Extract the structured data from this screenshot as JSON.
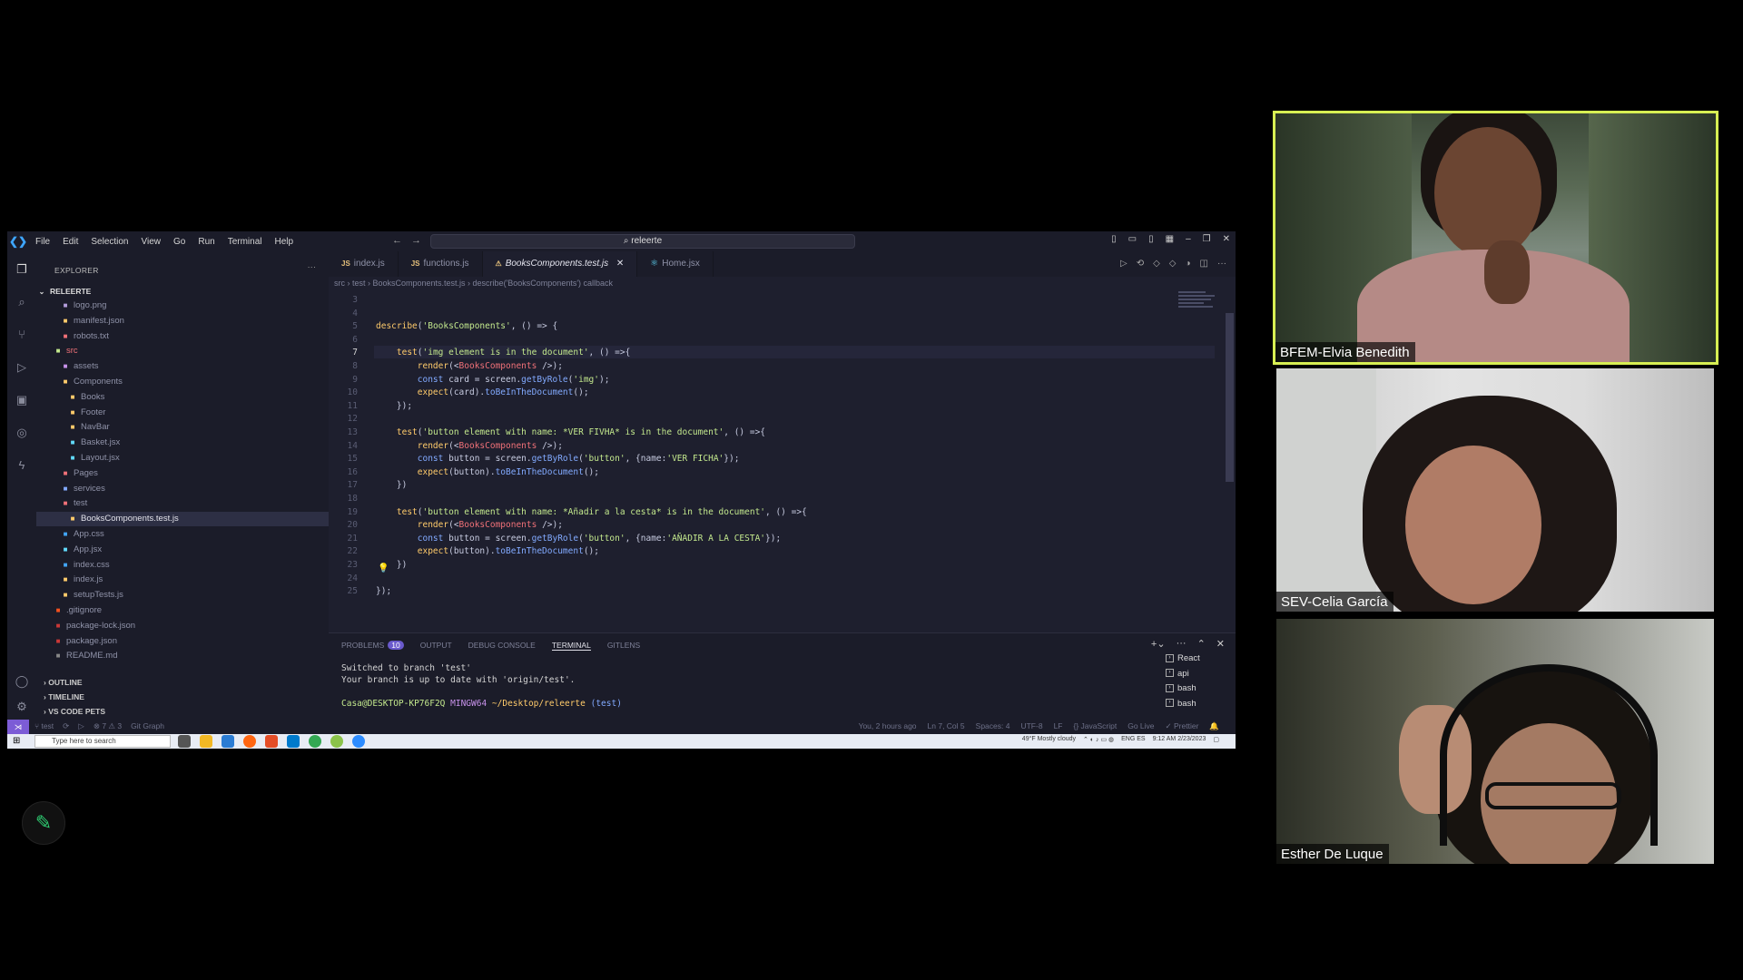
{
  "titlebar": {
    "menu": [
      "File",
      "Edit",
      "Selection",
      "View",
      "Go",
      "Run",
      "Terminal",
      "Help"
    ],
    "search_value": "releerte"
  },
  "explorer": {
    "header": "EXPLORER",
    "project": "RELEERTE",
    "items": [
      {
        "label": "logo.png",
        "indent": 2,
        "icon": "image-icon",
        "color": "#b39ddb"
      },
      {
        "label": "manifest.json",
        "indent": 2,
        "icon": "json-icon",
        "color": "#ffcb6b"
      },
      {
        "label": "robots.txt",
        "indent": 2,
        "icon": "text-file-icon",
        "color": "#f07178"
      },
      {
        "label": "src",
        "indent": 1,
        "icon": "folder-open-icon",
        "color": "#c3e88d",
        "text_color": "#f07178"
      },
      {
        "label": "assets",
        "indent": 2,
        "icon": "folder-icon",
        "color": "#c792ea"
      },
      {
        "label": "Components",
        "indent": 2,
        "icon": "folder-open-icon",
        "color": "#ffcb6b"
      },
      {
        "label": "Books",
        "indent": 3,
        "icon": "folder-icon",
        "color": "#ffcb6b"
      },
      {
        "label": "Footer",
        "indent": 3,
        "icon": "folder-icon",
        "color": "#ffcb6b"
      },
      {
        "label": "NavBar",
        "indent": 3,
        "icon": "folder-icon",
        "color": "#ffcb6b"
      },
      {
        "label": "Basket.jsx",
        "indent": 3,
        "icon": "react-icon",
        "color": "#61dafb"
      },
      {
        "label": "Layout.jsx",
        "indent": 3,
        "icon": "react-icon",
        "color": "#61dafb"
      },
      {
        "label": "Pages",
        "indent": 2,
        "icon": "folder-icon",
        "color": "#f07178"
      },
      {
        "label": "services",
        "indent": 2,
        "icon": "folder-icon",
        "color": "#82aaff"
      },
      {
        "label": "test",
        "indent": 2,
        "icon": "folder-open-icon",
        "color": "#f07178"
      },
      {
        "label": "BooksComponents.test.js",
        "indent": 3,
        "icon": "test-icon",
        "color": "#ffcb6b",
        "selected": true
      },
      {
        "label": "App.css",
        "indent": 2,
        "icon": "css-icon",
        "color": "#42a5f5"
      },
      {
        "label": "App.jsx",
        "indent": 2,
        "icon": "react-icon",
        "color": "#61dafb"
      },
      {
        "label": "index.css",
        "indent": 2,
        "icon": "css-icon",
        "color": "#42a5f5"
      },
      {
        "label": "index.js",
        "indent": 2,
        "icon": "js-icon",
        "color": "#ffcb6b"
      },
      {
        "label": "setupTests.js",
        "indent": 2,
        "icon": "js-icon",
        "color": "#ffcb6b"
      },
      {
        "label": ".gitignore",
        "indent": 1,
        "icon": "git-icon",
        "color": "#f4511e"
      },
      {
        "label": "package-lock.json",
        "indent": 1,
        "icon": "npm-icon",
        "color": "#cb3837"
      },
      {
        "label": "package.json",
        "indent": 1,
        "icon": "npm-icon",
        "color": "#cb3837"
      },
      {
        "label": "README.md",
        "indent": 1,
        "icon": "markdown-icon",
        "color": "#888"
      }
    ],
    "sections": [
      "OUTLINE",
      "TIMELINE",
      "VS CODE PETS"
    ]
  },
  "tabs": [
    {
      "label": "index.js",
      "lang": "JS"
    },
    {
      "label": "functions.js",
      "lang": "JS"
    },
    {
      "label": "BooksComponents.test.js",
      "lang": "test",
      "active": true
    },
    {
      "label": "Home.jsx",
      "lang": "react"
    }
  ],
  "breadcrumb": "src › test › BooksComponents.test.js › describe('BooksComponents') callback",
  "editor": {
    "lines": [
      {
        "n": "3",
        "code": ""
      },
      {
        "n": "4",
        "code": ""
      },
      {
        "n": "5",
        "code": "describe('BooksComponents', () => {"
      },
      {
        "n": "6",
        "code": ""
      },
      {
        "n": "7",
        "code": "    test('img element is in the document', () =>{"
      },
      {
        "n": "8",
        "code": "        render(<BooksComponents />);"
      },
      {
        "n": "9",
        "code": "        const card = screen.getByRole('img');"
      },
      {
        "n": "10",
        "code": "        expect(card).toBeInTheDocument();"
      },
      {
        "n": "11",
        "code": "    });"
      },
      {
        "n": "12",
        "code": ""
      },
      {
        "n": "13",
        "code": "    test('button element with name: *VER FIVHA* is in the document', () =>{"
      },
      {
        "n": "14",
        "code": "        render(<BooksComponents />);"
      },
      {
        "n": "15",
        "code": "        const button = screen.getByRole('button', {name:'VER FICHA'});"
      },
      {
        "n": "16",
        "code": "        expect(button).toBeInTheDocument();"
      },
      {
        "n": "17",
        "code": "    })"
      },
      {
        "n": "18",
        "code": ""
      },
      {
        "n": "19",
        "code": "    test('button element with name: *Añadir a la cesta* is in the document', () =>{"
      },
      {
        "n": "20",
        "code": "        render(<BooksComponents />);"
      },
      {
        "n": "21",
        "code": "        const button = screen.getByRole('button', {name:'AÑADIR A LA CESTA'});"
      },
      {
        "n": "22",
        "code": "        expect(button).toBeInTheDocument();"
      },
      {
        "n": "23",
        "code": "    })"
      },
      {
        "n": "24",
        "code": ""
      },
      {
        "n": "25",
        "code": "});"
      }
    ],
    "current_line": "7"
  },
  "panel": {
    "tabs": [
      "PROBLEMS",
      "OUTPUT",
      "DEBUG CONSOLE",
      "TERMINAL",
      "GITLENS"
    ],
    "problems_count": "10",
    "active_tab": "TERMINAL",
    "terminal_lines": [
      "Switched to branch 'test'",
      "Your branch is up to date with 'origin/test'."
    ],
    "prompt": {
      "user": "Casa@DESKTOP-KP76F2Q",
      "shell": "MINGW64",
      "path": "~/Desktop/releerte",
      "branch": "(test)"
    },
    "terminals": [
      "React",
      "api",
      "bash",
      "bash"
    ]
  },
  "statusbar": {
    "left": [
      "test",
      "⊗ 7 ⚠ 3",
      "Git Graph"
    ],
    "right": [
      "You, 2 hours ago",
      "Ln 7, Col 5",
      "Spaces: 4",
      "UTF-8",
      "LF",
      "{} JavaScript",
      "Go Live",
      "✓ Prettier"
    ]
  },
  "taskbar": {
    "search_placeholder": "Type here to search",
    "weather": "49°F  Mostly cloudy",
    "lang": "ENG ES",
    "time": "9:12 AM",
    "date": "2/23/2023"
  },
  "participants": [
    {
      "name": "BFEM-Elvia Benedith",
      "active_speaker": true
    },
    {
      "name": "SEV-Celia García"
    },
    {
      "name": "Esther De Luque"
    }
  ],
  "colors": {
    "active_speaker_border": "#d7ef53",
    "accent": "#7c5cd6"
  }
}
